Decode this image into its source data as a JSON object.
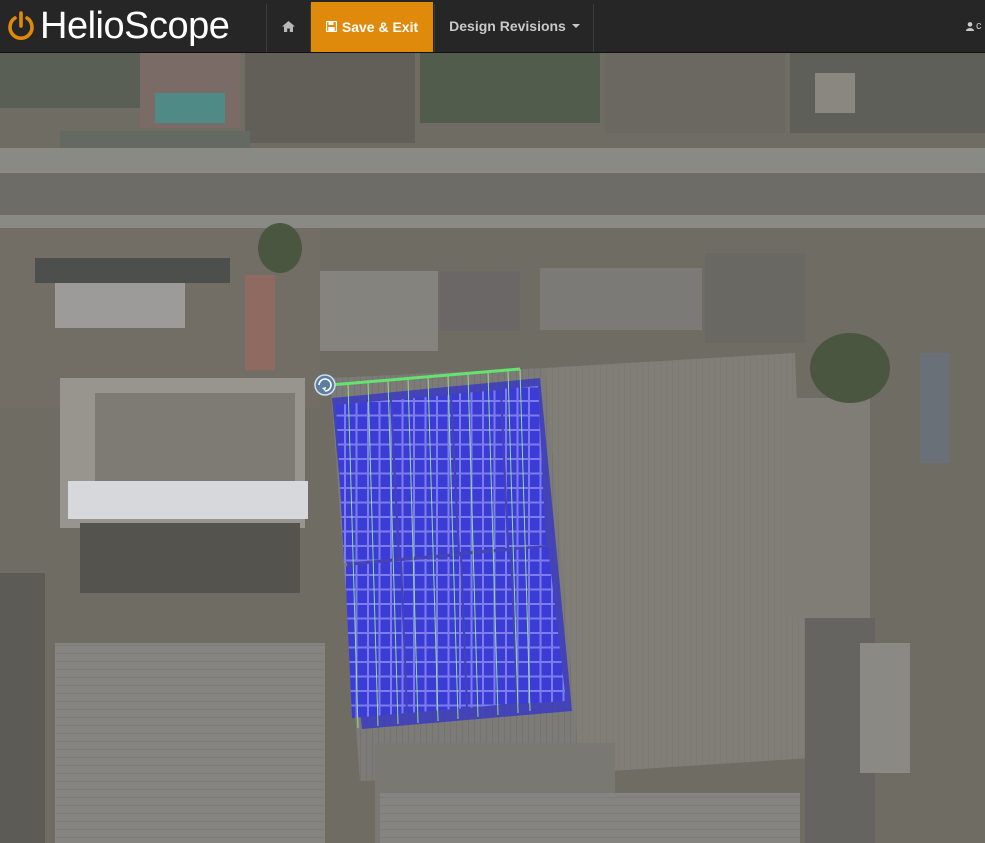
{
  "app": {
    "brand_name": "HelioScope",
    "brand_color": "#e08a0b"
  },
  "topbar": {
    "home_icon": "home-icon",
    "save_button_label": "Save & Exit",
    "save_icon": "floppy-disk-icon",
    "design_revisions_label": "Design Revisions",
    "user_icon": "user-icon",
    "user_label": "c"
  },
  "map": {
    "layer": "satellite-imagery",
    "array_color": "#3a3ad8",
    "azimuth_handle_icon": "rotate-handle-icon"
  }
}
